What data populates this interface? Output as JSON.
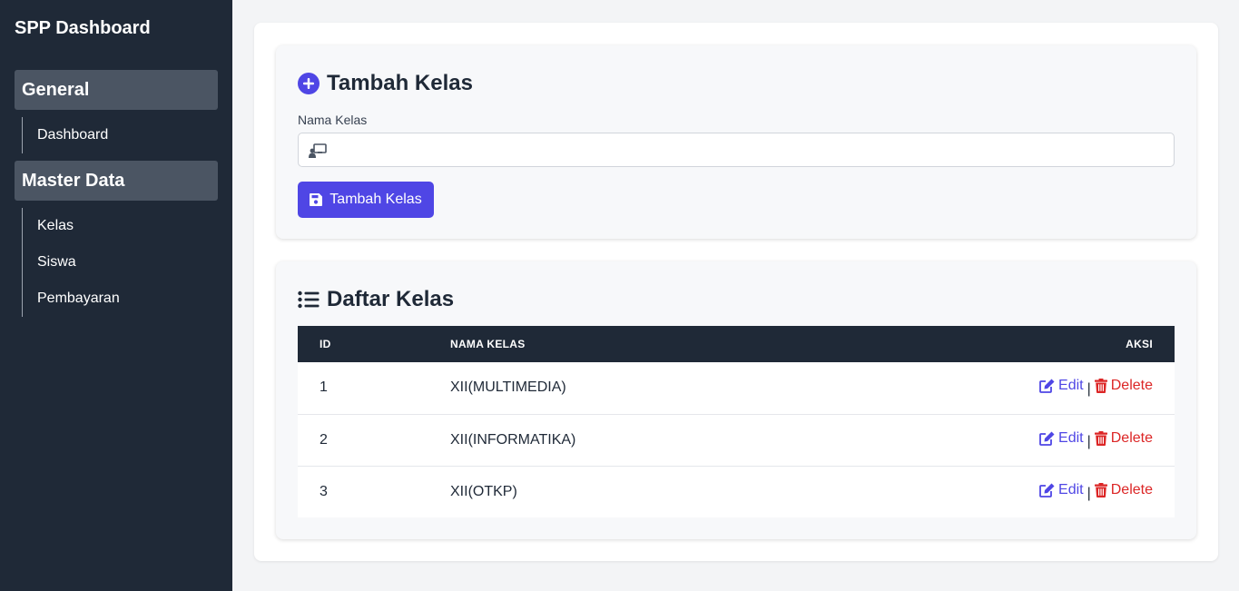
{
  "sidebar": {
    "brand": "SPP Dashboard",
    "groups": [
      {
        "title": "General",
        "items": [
          "Dashboard"
        ]
      },
      {
        "title": "Master Data",
        "items": [
          "Kelas",
          "Siswa",
          "Pembayaran"
        ]
      }
    ]
  },
  "form": {
    "title": "Tambah Kelas",
    "field_label": "Nama Kelas",
    "field_value": "",
    "field_placeholder": "",
    "button_label": "Tambah Kelas",
    "icon": "plus-circle-icon",
    "field_icon": "chalkboard-teacher-icon",
    "button_icon": "save-icon"
  },
  "list": {
    "title": "Daftar Kelas",
    "icon": "list-icon",
    "columns": {
      "id": "ID",
      "name": "NAMA KELAS",
      "action": "AKSI"
    },
    "rows": [
      {
        "id": "1",
        "name": "XII(MULTIMEDIA)"
      },
      {
        "id": "2",
        "name": "XII(INFORMATIKA)"
      },
      {
        "id": "3",
        "name": "XII(OTKP)"
      }
    ],
    "edit_label": "Edit",
    "delete_label": "Delete",
    "separator": "|"
  },
  "colors": {
    "sidebar_bg": "#1f2937",
    "group_bg": "#4b5563",
    "accent": "#4f46e5",
    "danger": "#dc2626"
  }
}
